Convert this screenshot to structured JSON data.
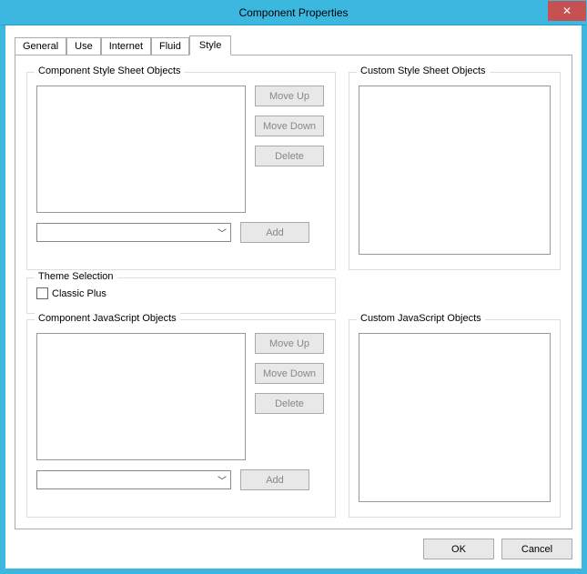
{
  "window": {
    "title": "Component Properties"
  },
  "tabs": {
    "general": "General",
    "use": "Use",
    "internet": "Internet",
    "fluid": "Fluid",
    "style": "Style"
  },
  "groups": {
    "comp_style": "Component Style Sheet Objects",
    "custom_style": "Custom Style Sheet Objects",
    "theme": "Theme Selection",
    "comp_js": "Component JavaScript Objects",
    "custom_js": "Custom JavaScript Objects"
  },
  "buttons": {
    "move_up": "Move Up",
    "move_down": "Move Down",
    "delete": "Delete",
    "add": "Add",
    "ok": "OK",
    "cancel": "Cancel"
  },
  "theme_checkbox": "Classic Plus"
}
